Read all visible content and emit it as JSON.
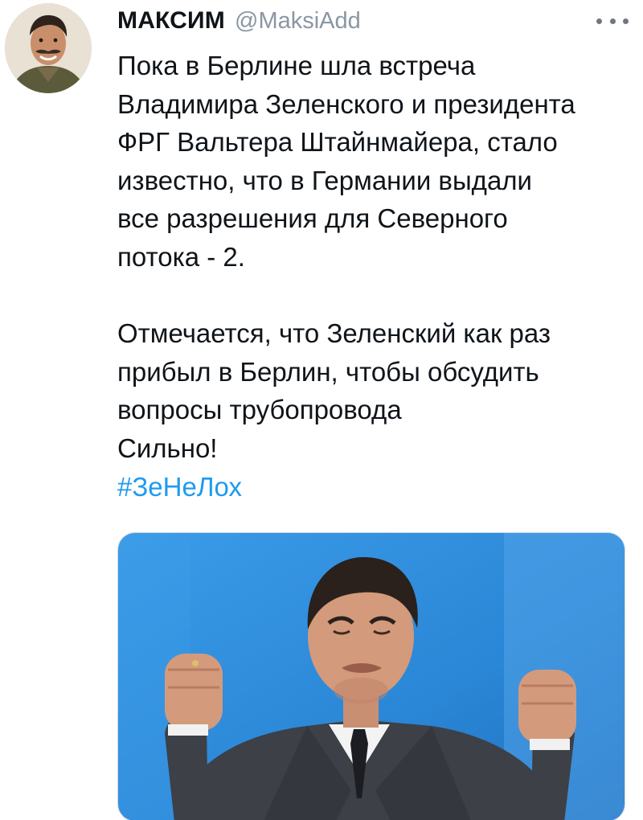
{
  "tweet": {
    "author": {
      "display_name": "МАКСИМ",
      "handle": "@MaksiAdd",
      "avatar_icon": "profile-photo"
    },
    "more_icon": "more-options-icon",
    "text_lines": [
      "Пока в Берлине шла встреча",
      "Владимира Зеленского и президента",
      "ФРГ Вальтера Штайнмайера, стало",
      "известно, что в Германии выдали",
      "все разрешения для Северного",
      "потока - 2.",
      "",
      "Отмечается, что Зеленский как раз",
      "прибыл в Берлин, чтобы обсудить",
      "вопросы трубопровода",
      "Сильно!"
    ],
    "hashtag": "#ЗеНеЛох",
    "colors": {
      "text": "#0f1419",
      "handle": "#8a96a3",
      "link": "#1d9bf0",
      "media_background": "#2f8fdc"
    }
  }
}
